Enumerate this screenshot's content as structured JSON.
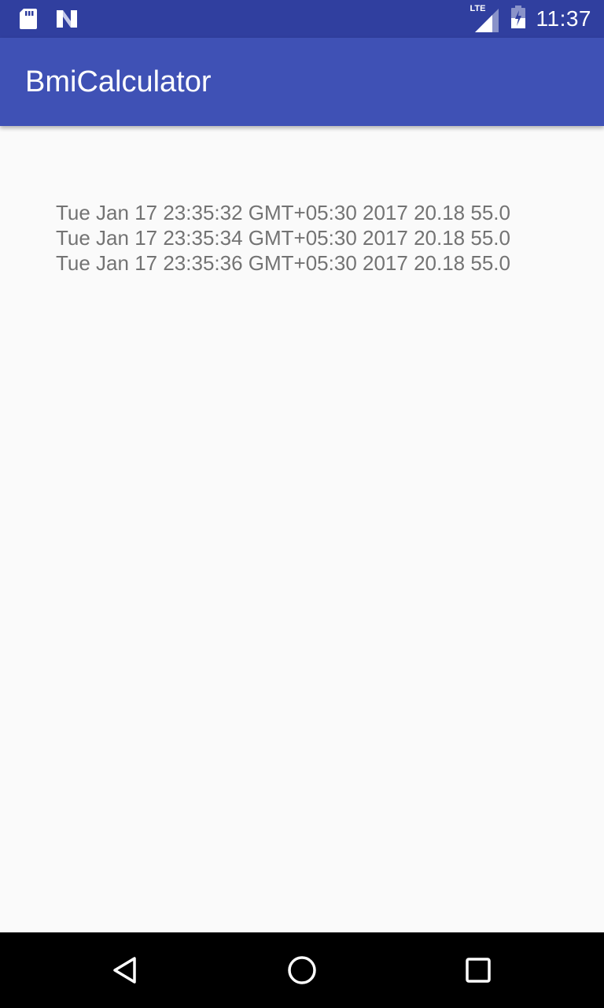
{
  "status_bar": {
    "time": "11:37",
    "network_label": "LTE",
    "icons": [
      "sd-card-icon",
      "n-notification-icon",
      "lte-signal-icon",
      "battery-charging-icon"
    ]
  },
  "app_bar": {
    "title": "BmiCalculator"
  },
  "records": [
    "Tue Jan 17 23:35:32 GMT+05:30 2017 20.18 55.0",
    "Tue Jan 17 23:35:34 GMT+05:30 2017 20.18 55.0",
    "Tue Jan 17 23:35:36 GMT+05:30 2017 20.18 55.0"
  ],
  "nav_bar": {
    "buttons": [
      "back-icon",
      "home-icon",
      "recents-icon"
    ]
  },
  "colors": {
    "status_bar": "#303F9F",
    "app_bar": "#3F51B5",
    "background": "#FAFAFA",
    "record_text": "#737373",
    "nav_bar": "#000000"
  }
}
